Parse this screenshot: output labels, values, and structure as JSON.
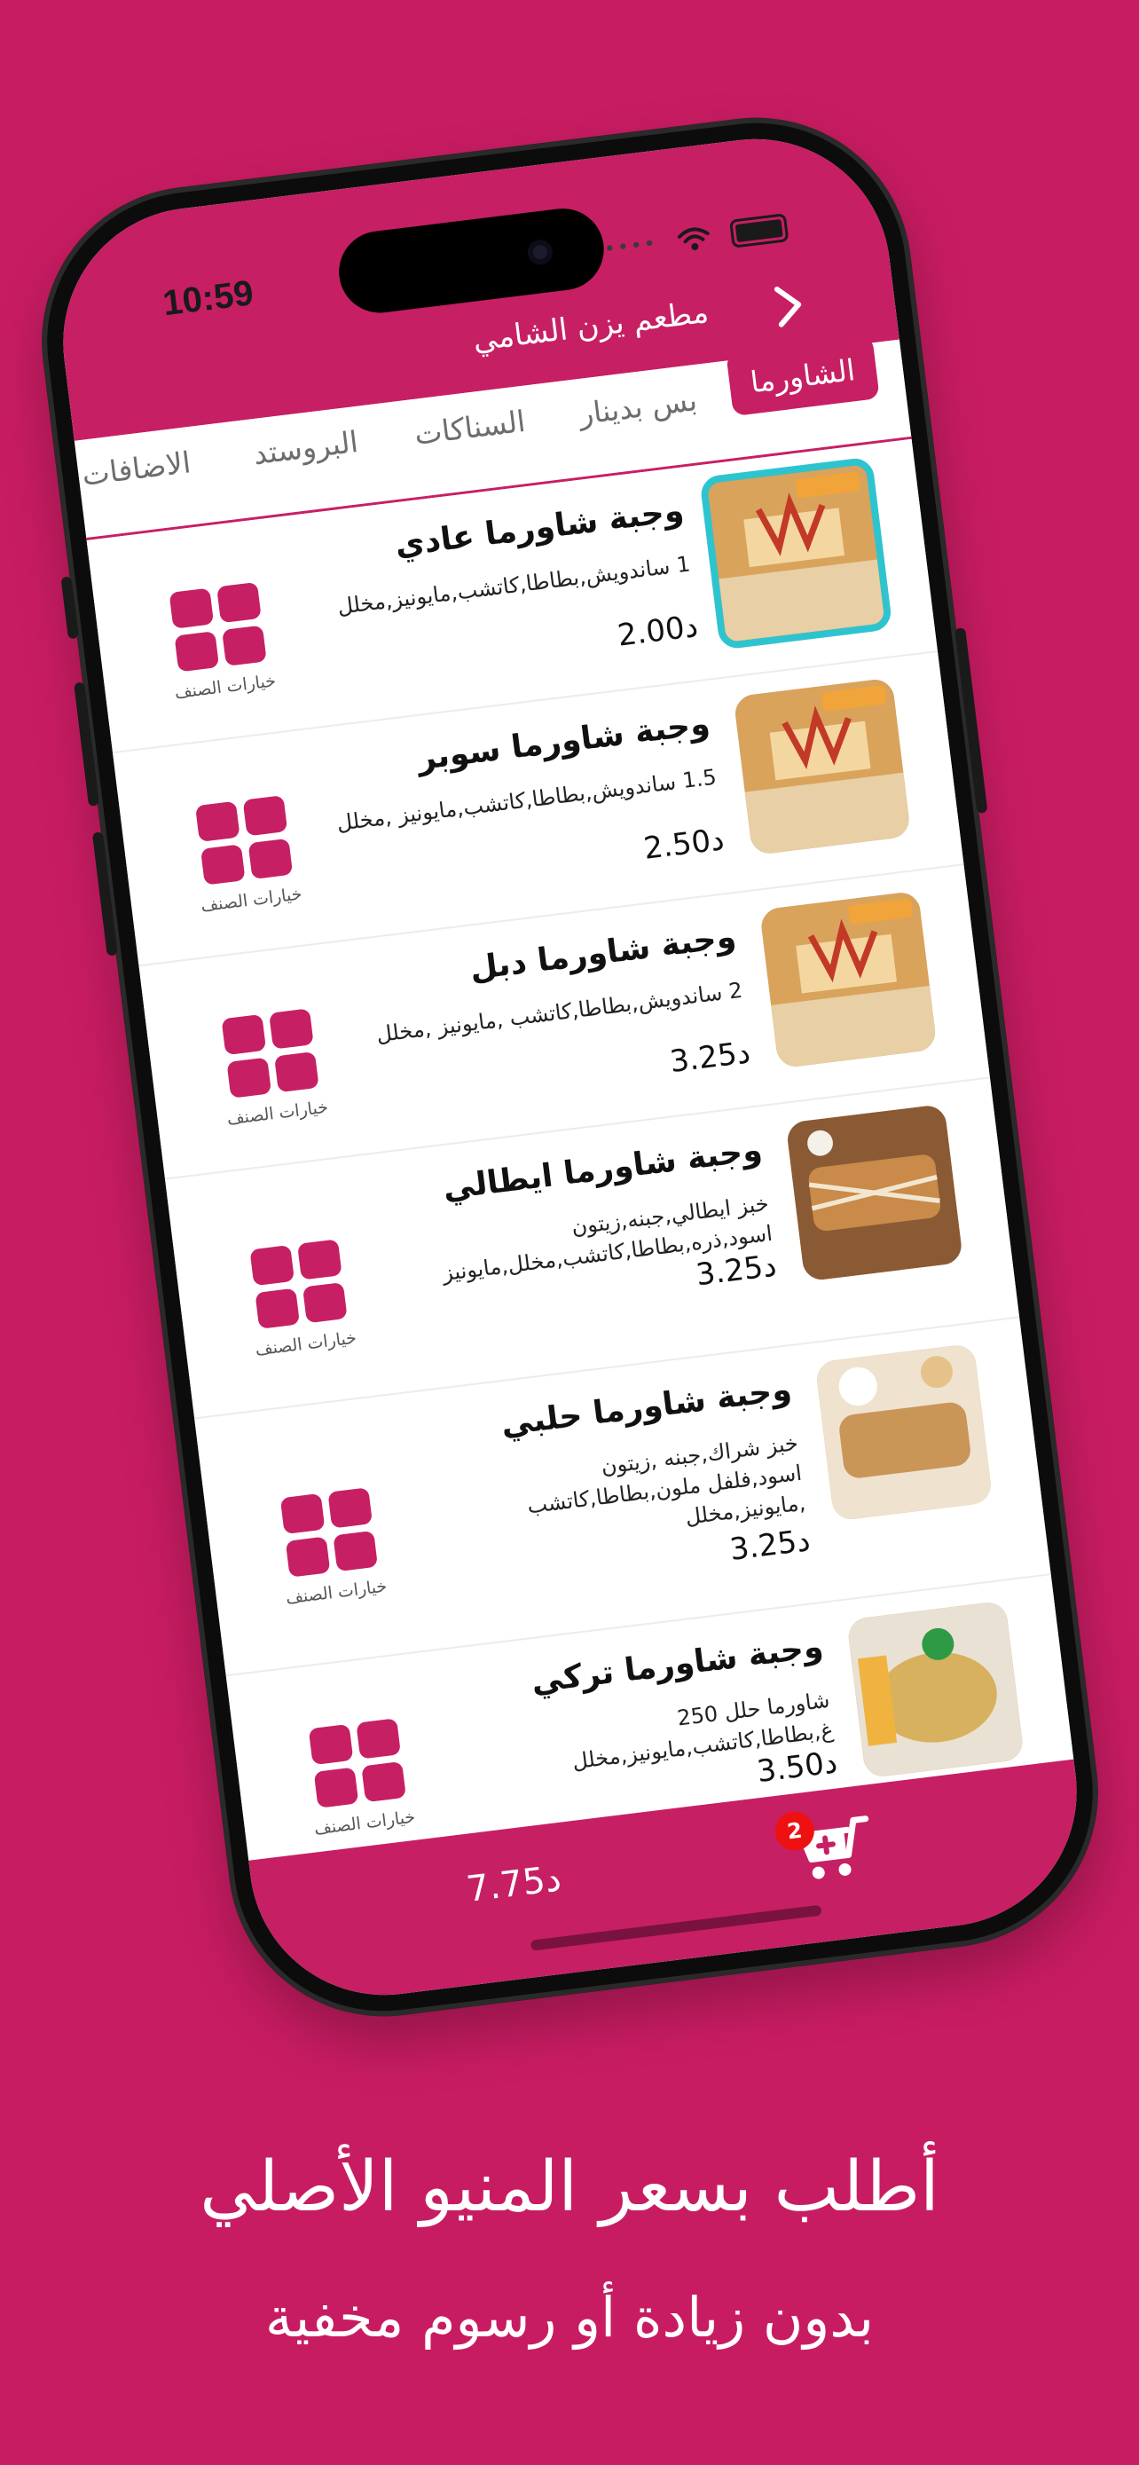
{
  "status": {
    "time": "10:59"
  },
  "header": {
    "restaurant_name": "مطعم يزن الشامي"
  },
  "tabs": [
    {
      "label": "الشاورما",
      "active": true
    },
    {
      "label": "بس بدينار",
      "active": false
    },
    {
      "label": "السناكات",
      "active": false
    },
    {
      "label": "البروستد",
      "active": false
    },
    {
      "label": "الاضافات",
      "active": false
    }
  ],
  "items": [
    {
      "title": "وجبة شاورما عادي",
      "desc": "1 ساندويش,بطاطا,كاتشب,مايونيز,مخلل",
      "price": "2.00د",
      "options_label": "خيارات الصنف",
      "selected": true
    },
    {
      "title": "وجبة شاورما سوبر",
      "desc": "1.5 ساندويش,بطاطا,كاتشب,مايونيز ,مخلل",
      "price": "2.50د",
      "options_label": "خيارات الصنف",
      "selected": false
    },
    {
      "title": "وجبة شاورما دبل",
      "desc": "2 ساندويش,بطاطا,كاتشب ,مايونيز ,مخلل",
      "price": "3.25د",
      "options_label": "خيارات الصنف",
      "selected": false
    },
    {
      "title": "وجبة شاورما ايطالي",
      "desc": "خبز ايطالي,جبنه,زيتون اسود,ذره,بطاطا,كاتشب,مخلل,مايونيز",
      "price": "3.25د",
      "options_label": "خيارات الصنف",
      "selected": false
    },
    {
      "title": "وجبة شاورما حلبي",
      "desc": "خبز شراك,جبنه ,زيتون اسود,فلفل ملون,بطاطا,كاتشب ,مايونيز,مخلل",
      "price": "3.25د",
      "options_label": "خيارات الصنف",
      "selected": false
    },
    {
      "title": "وجبة شاورما تركي",
      "desc": "شاورما حلل 250 غ,بطاطا,كاتشب,مايونيز,مخلل",
      "price": "3.50د",
      "options_label": "خيارات الصنف",
      "selected": false
    }
  ],
  "cart": {
    "total": "7.75د",
    "count": "2"
  },
  "promo": {
    "headline": "أطلب بسعر المنيو الأصلي",
    "subline": "بدون زيادة أو رسوم مخفية"
  },
  "colors": {
    "brand": "#C71F64",
    "background": "#C81C62",
    "selected_border": "#2EC4CF",
    "badge": "#E11111"
  }
}
